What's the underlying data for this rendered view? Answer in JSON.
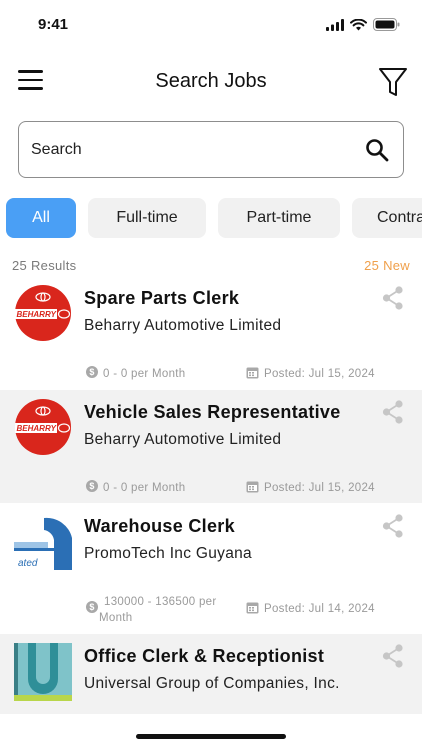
{
  "status_bar": {
    "time": "9:41"
  },
  "header": {
    "title": "Search Jobs",
    "menu_icon": "hamburger-menu-icon",
    "filter_icon": "filter-funnel-icon"
  },
  "search": {
    "placeholder": "Search",
    "value": "",
    "icon": "search-icon"
  },
  "filters": [
    {
      "label": "All",
      "active": true
    },
    {
      "label": "Full-time",
      "active": false
    },
    {
      "label": "Part-time",
      "active": false
    },
    {
      "label": "Contra",
      "active": false
    }
  ],
  "results": {
    "count_text": "25 Results",
    "new_text": "25 New"
  },
  "colors": {
    "accent": "#4a9ff5",
    "new_badge": "#f0a04b",
    "logo_red": "#d9261c",
    "alt_row": "#f2f2f2"
  },
  "jobs": [
    {
      "title": "Spare Parts Clerk",
      "company": "Beharry Automotive Limited",
      "salary": "0 - 0 per Month",
      "posted": "Posted: Jul 15, 2024",
      "logo_text": "BEHARRY"
    },
    {
      "title": "Vehicle Sales Representative",
      "company": "Beharry Automotive Limited",
      "salary": "0 - 0 per Month",
      "posted": "Posted: Jul 15, 2024",
      "logo_text": "BEHARRY"
    },
    {
      "title": "Warehouse Clerk",
      "company": "PromoTech Inc Guyana",
      "salary_line1": "130000 - 136500 per",
      "salary_line2": "Month",
      "posted": "Posted: Jul 14, 2024",
      "logo_text": "ated"
    },
    {
      "title": "Office Clerk & Receptionist",
      "company": "Universal Group of Companies, Inc."
    }
  ]
}
